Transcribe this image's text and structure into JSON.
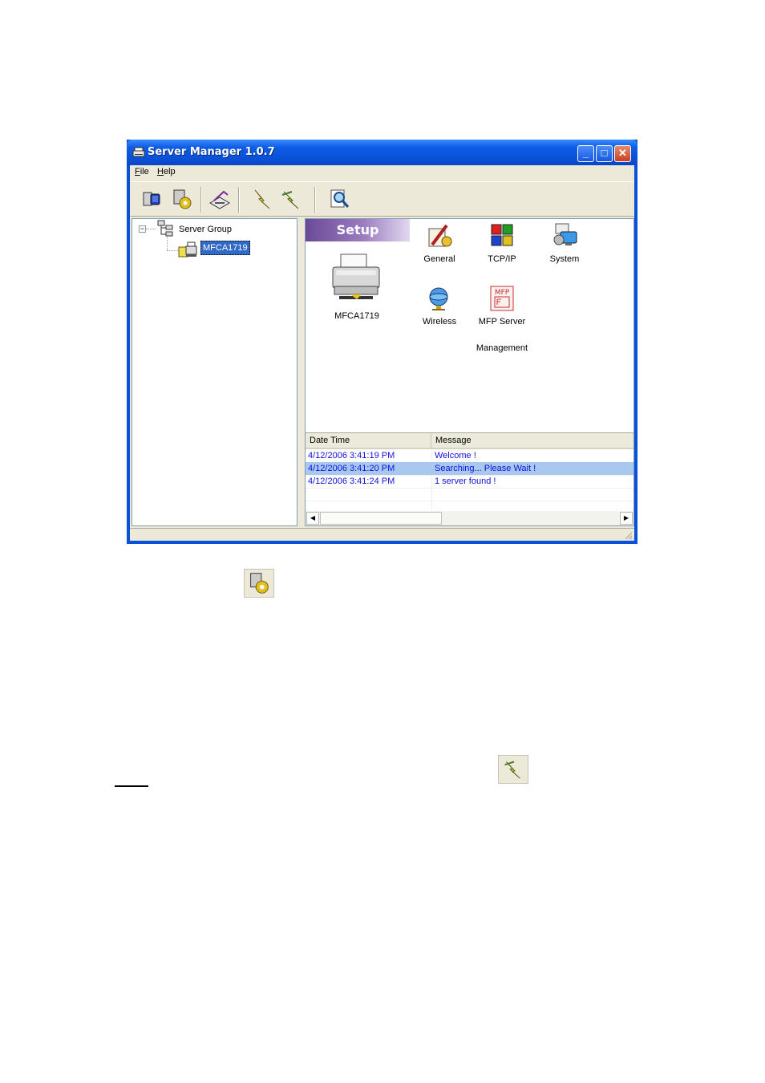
{
  "window": {
    "title": "Server Manager 1.0.7",
    "controls": {
      "minimize": "_",
      "maximize": "□",
      "close": "✕"
    }
  },
  "menu": [
    {
      "key": "F",
      "rest": "ile"
    },
    {
      "key": "H",
      "rest": "elp"
    }
  ],
  "toolbar": {
    "icons": [
      "server-search-icon",
      "server-settings-icon",
      "printer-properties-icon",
      "connect-icon",
      "disconnect-icon",
      "find-icon"
    ]
  },
  "tree": {
    "root": "Server Group",
    "child": "MFCA1719",
    "expander": "−"
  },
  "setup": {
    "banner": "Setup",
    "device_label": "MFCA1719",
    "items": [
      {
        "label": "General"
      },
      {
        "label": "TCP/IP"
      },
      {
        "label": "System"
      },
      {
        "label": "Wireless"
      },
      {
        "label_line1": "MFP Server",
        "label_line2": "Management",
        "badge": "MFP"
      }
    ]
  },
  "log": {
    "columns": [
      "Date Time",
      "Message"
    ],
    "rows": [
      {
        "time": "4/12/2006 3:41:19 PM",
        "message": "Welcome !"
      },
      {
        "time": "4/12/2006 3:41:20 PM",
        "message": "Searching... Please Wait !"
      },
      {
        "time": "4/12/2006 3:41:24 PM",
        "message": "1 server found !"
      }
    ],
    "selected_row": 1
  },
  "scroll": {
    "left": "◀",
    "right": "▶"
  },
  "colors": {
    "title_blue": "#0a52d8",
    "selection": "#316ac5",
    "log_text": "#1010e0",
    "log_selected": "#a8c8f0",
    "chrome": "#ece9d8"
  }
}
